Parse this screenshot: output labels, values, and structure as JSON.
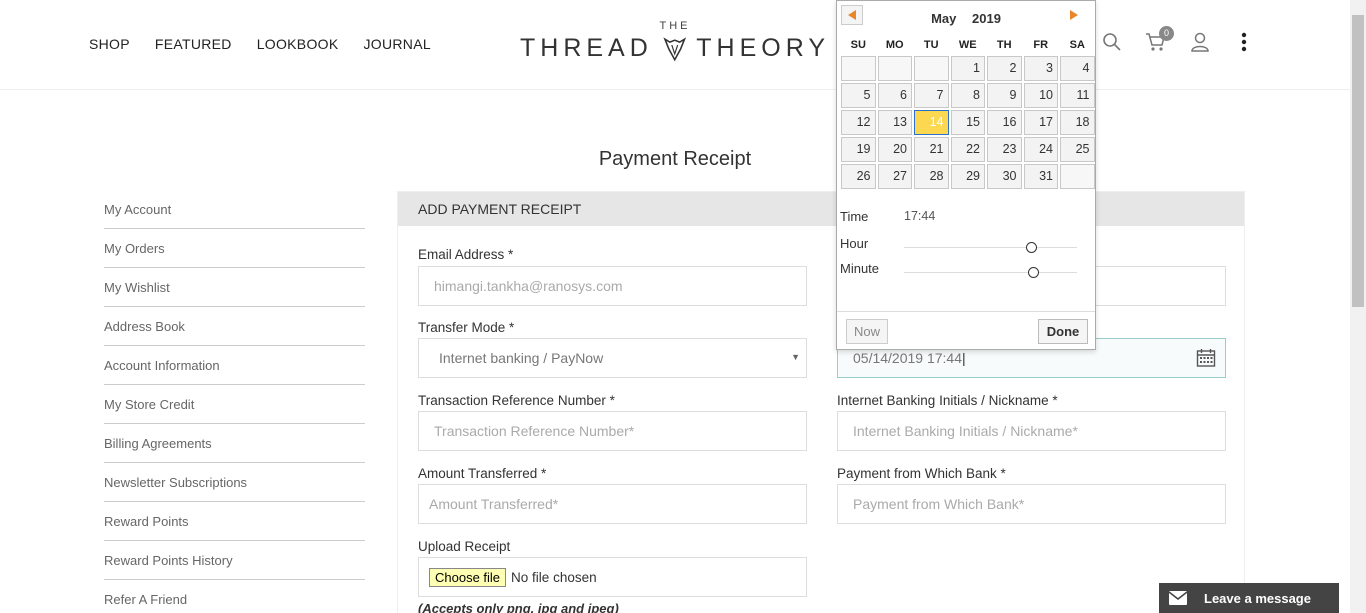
{
  "nav": [
    "SHOP",
    "FEATURED",
    "LOOKBOOK",
    "JOURNAL"
  ],
  "logo": {
    "top": "THE",
    "left": "THREAD",
    "right": "THEORY"
  },
  "cart_count": "0",
  "page_title": "Payment Receipt",
  "sidebar": [
    "My Account",
    "My Orders",
    "My Wishlist",
    "Address Book",
    "Account Information",
    "My Store Credit",
    "Billing Agreements",
    "Newsletter Subscriptions",
    "Reward Points",
    "Reward Points History",
    "Refer A Friend"
  ],
  "panel_title": "ADD PAYMENT RECEIPT",
  "form": {
    "email_label": "Email Address *",
    "email_value": "himangi.tankha@ranosys.com",
    "transfer_label": "Transfer Mode *",
    "transfer_value": "Internet banking / PayNow",
    "date_value": "05/14/2019 17:44",
    "txn_label": "Transaction Reference Number *",
    "txn_placeholder": "Transaction Reference Number*",
    "ib_label": "Internet Banking Initials / Nickname *",
    "ib_placeholder": "Internet Banking Initials / Nickname*",
    "amount_label": "Amount Transferred *",
    "amount_placeholder": "Amount Transferred*",
    "bank_label": "Payment from Which Bank *",
    "bank_placeholder": "Payment from Which Bank*",
    "upload_label": "Upload Receipt",
    "choose_file": "Choose file",
    "no_file": "No file chosen",
    "upload_note": "(Accepts only png, jpg and jpeg)"
  },
  "datepicker": {
    "month": "May",
    "year": "2019",
    "dow": [
      "SU",
      "MO",
      "TU",
      "WE",
      "TH",
      "FR",
      "SA"
    ],
    "weeks": [
      [
        "",
        "",
        "",
        "1",
        "2",
        "3",
        "4"
      ],
      [
        "5",
        "6",
        "7",
        "8",
        "9",
        "10",
        "11"
      ],
      [
        "12",
        "13",
        "14",
        "15",
        "16",
        "17",
        "18"
      ],
      [
        "19",
        "20",
        "21",
        "22",
        "23",
        "24",
        "25"
      ],
      [
        "26",
        "27",
        "28",
        "29",
        "30",
        "31",
        ""
      ]
    ],
    "selected": "14",
    "time_label": "Time",
    "time_value": "17:44",
    "hour_label": "Hour",
    "minute_label": "Minute",
    "hour_fraction": 0.739,
    "minute_fraction": 0.746,
    "now_label": "Now",
    "done_label": "Done",
    "colors": {
      "today_bg": "#fbd850",
      "today_border": "#2a6fc9",
      "arrow": "#e8862a"
    }
  },
  "chat_label": "Leave a message"
}
